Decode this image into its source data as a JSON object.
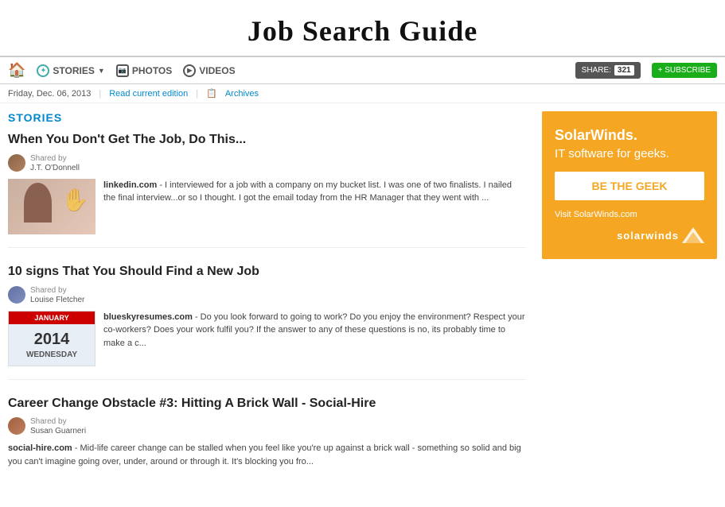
{
  "header": {
    "title": "Job Search Guide"
  },
  "navbar": {
    "home_label": "🏠",
    "stories_label": "STORIES",
    "photos_label": "PHOTOS",
    "videos_label": "VIDEOS",
    "share_label": "SHARE:",
    "share_count": "321",
    "subscribe_label": "+ SUBSCRIBE"
  },
  "subbar": {
    "date": "Friday, Dec. 06, 2013",
    "read_edition": "Read current edition",
    "archives": "Archives"
  },
  "stories_section": {
    "heading": "STORIES"
  },
  "stories": [
    {
      "title": "When You Don't Get The Job, Do This...",
      "shared_by_label": "Shared by",
      "author": "J.T. O'Donnell",
      "source": "linkedin.com",
      "excerpt": "- I interviewed for a job with a company on my bucket list. I was one of two finalists. I nailed the final interview...or so I thought. I got the email today from the HR Manager that they went with ..."
    },
    {
      "title": "10 signs That You Should Find a New Job",
      "shared_by_label": "Shared by",
      "author": "Louise Fletcher",
      "source": "blueskyresumes.com",
      "excerpt": "- Do you look forward to going to work? Do you enjoy the environment? Respect your co-workers? Does your work fulfil you? If the answer to any of these questions is no, its probably time to make a c..."
    },
    {
      "title": "Career Change Obstacle #3: Hitting A Brick Wall - Social-Hire",
      "shared_by_label": "Shared by",
      "author": "Susan Guarneri",
      "source": "social-hire.com",
      "excerpt": "- Mid-life career change can be stalled when you feel like you're up against a brick wall - something so solid and big you can't imagine going over, under, around or through it. It's blocking you fro..."
    }
  ],
  "ad": {
    "title": "SolarWinds.",
    "subtitle": "IT software for geeks.",
    "cta": "BE THE GEEK",
    "visit": "Visit SolarWinds.com",
    "brand": "solarwinds"
  }
}
